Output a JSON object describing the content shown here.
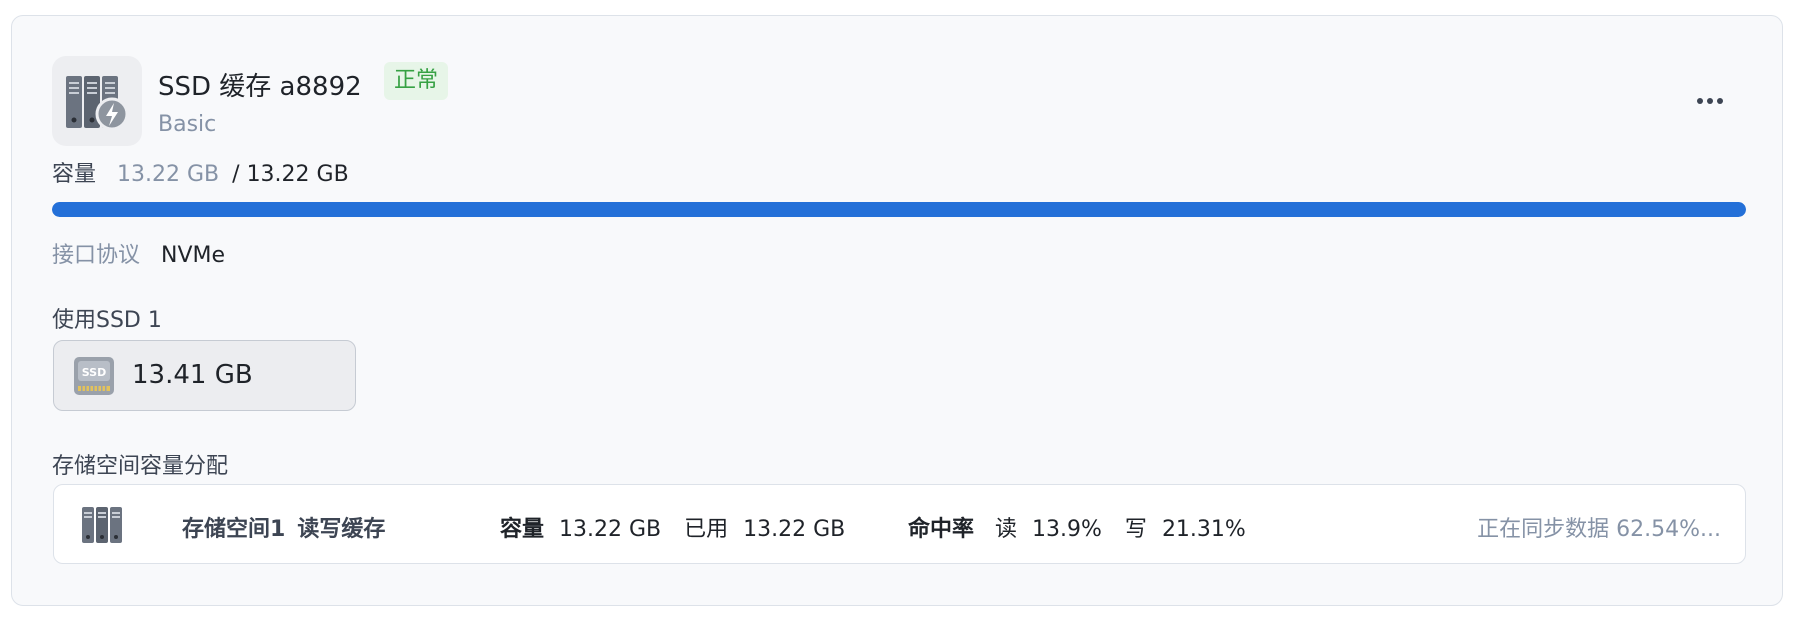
{
  "header": {
    "title": "SSD 缓存 a8892",
    "status": "正常",
    "type": "Basic",
    "icon": "server-cache-icon",
    "more_icon": "more-horizontal-icon"
  },
  "capacity": {
    "label": "容量",
    "used": "13.22 GB",
    "separator": "/",
    "total": "13.22 GB",
    "fill_ratio": 1.0
  },
  "protocol": {
    "label": "接口协议",
    "value": "NVMe"
  },
  "ssd": {
    "title": "使用SSD 1",
    "icon_text": "SSD",
    "size": "13.41 GB"
  },
  "allocation": {
    "title": "存储空间容量分配",
    "rows": [
      {
        "name": "存储空间1",
        "mode": "读写缓存",
        "capacity_label": "容量",
        "capacity_value": "13.22 GB",
        "used_label": "已用",
        "used_value": "13.22 GB",
        "hit_label": "命中率",
        "read_label": "读",
        "read_value": "13.9%",
        "write_label": "写",
        "write_value": "21.31%",
        "sync_status": "正在同步数据 62.54%..."
      }
    ]
  },
  "colors": {
    "accent": "#2470d8",
    "status_green": "#37a144",
    "muted_text": "#8592a6"
  }
}
